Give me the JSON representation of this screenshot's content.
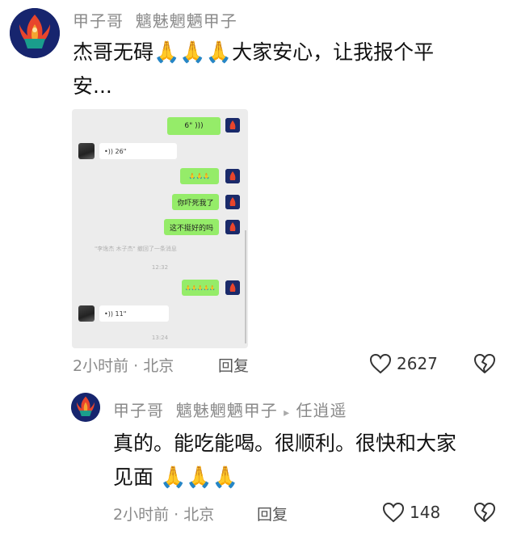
{
  "comment": {
    "username": "甲子哥",
    "nickname": "魑魅魍魉甲子",
    "text_line1": "杰哥无碍",
    "text_line1_after": "大家安心，让我报个平",
    "text_line2": "安...",
    "emoji": "🙏🙏🙏",
    "time": "2小时前 · 北京",
    "reply_label": "回复",
    "like_count": "2627"
  },
  "chat_screenshot": {
    "msg_voice_6": "6\"",
    "msg_voice_26": "26\"",
    "msg_emoji": "🙏🙏🙏",
    "msg_scared": "你吓死我了",
    "msg_fine": "这不挺好的吗",
    "sys_notice": "\"李逸杰 木子杰\" 撤回了一条消息",
    "time_1": "12:32",
    "msg_emoji_small": "🙏🙏🙏🙏🙏",
    "msg_voice_11": "11\"",
    "time_2": "13:24"
  },
  "reply": {
    "username": "甲子哥",
    "nickname": "魑魅魍魉甲子",
    "arrow": "▸",
    "target": "任逍遥",
    "text_line1": "真的。能吃能喝。很顺利。很快和大家",
    "text_line2": "见面",
    "emoji": "🙏🙏🙏",
    "time": "2小时前 · 北京",
    "reply_label": "回复",
    "like_count": "148"
  },
  "icons": {
    "like": "heart-outline-icon",
    "dislike": "broken-heart-icon"
  },
  "colors": {
    "chat_green": "#95ec69",
    "avatar_bg": "#1a2a6a",
    "meta_gray": "#8a8a8a"
  }
}
